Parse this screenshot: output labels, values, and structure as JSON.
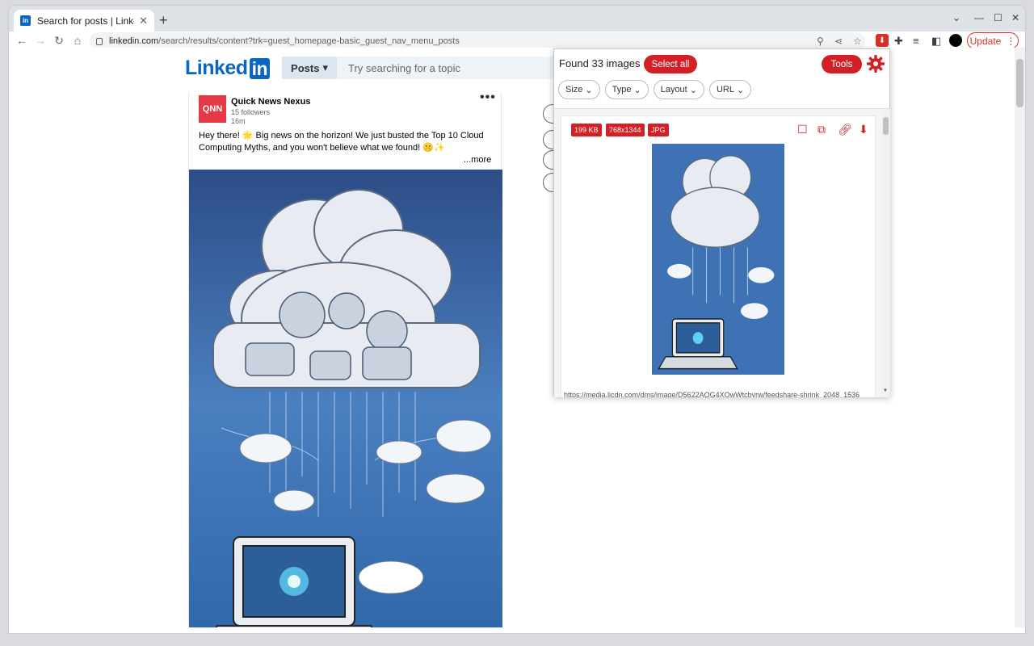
{
  "browser": {
    "tab_title": "Search for posts | Linkedi",
    "tab_favicon": "in",
    "tab_close": "✕",
    "new_tab": "+",
    "url_host": "linkedin.com",
    "url_path": "/search/results/content?trk=guest_homepage-basic_guest_nav_menu_posts",
    "update_label": "Update"
  },
  "linkedin": {
    "logo_text": "Linked",
    "logo_in": "in",
    "search_filter": "Posts",
    "search_placeholder": "Try searching for a topic"
  },
  "post": {
    "avatar_text": "QNN",
    "author": "Quick News Nexus",
    "followers": "15 followers",
    "time": "16m",
    "body": "Hey there! 🌟 Big news on the horizon! We just busted the Top 10 Cloud Computing Myths, and you won't believe what we found! 🤫✨",
    "more": "...more"
  },
  "popup": {
    "found_text": "Found 33 images",
    "select_all": "Select all",
    "tools": "Tools",
    "filters": [
      "Size",
      "Type",
      "Layout",
      "URL"
    ],
    "image": {
      "size": "199 KB",
      "dimensions": "768x1344",
      "format": "JPG",
      "url": "https://media.licdn.com/dms/image/D5622AQG4XOwWtcbyrw/feedshare-shrink_2048_1536"
    }
  },
  "colors": {
    "linkedin_blue": "#0a66c2",
    "accent_red": "#d32027"
  }
}
